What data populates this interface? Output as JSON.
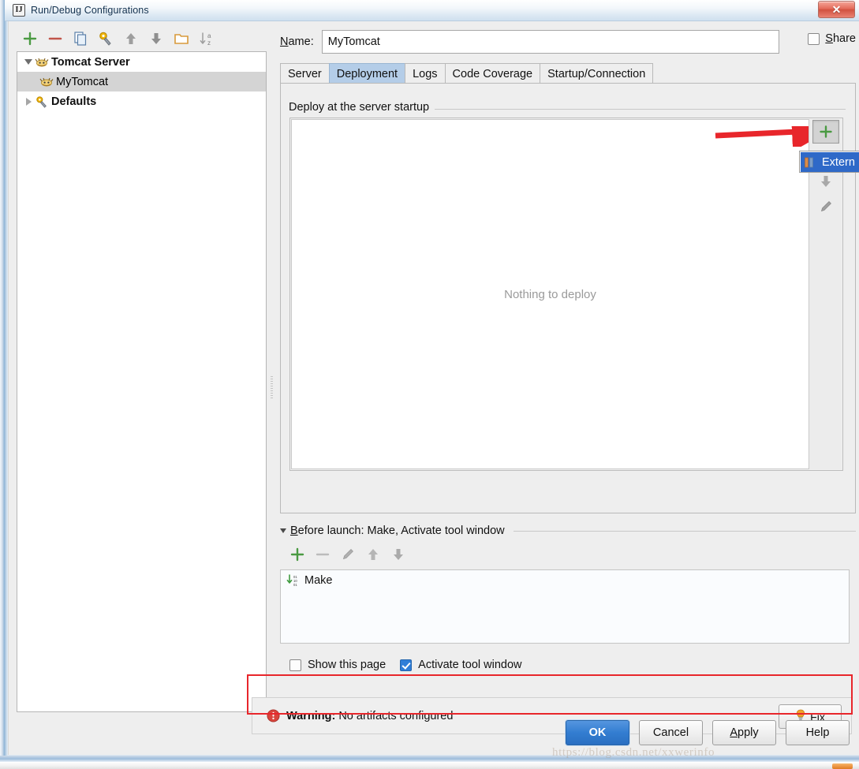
{
  "window": {
    "title": "Run/Debug Configurations",
    "app_icon": "intellij-idea-icon",
    "close_label": "✕"
  },
  "left_toolbar": {
    "items": [
      {
        "name": "add-configuration-button",
        "icon": "plus-icon",
        "tooltip": "Add New Configuration"
      },
      {
        "name": "remove-configuration-button",
        "icon": "minus-icon",
        "tooltip": "Remove Configuration"
      },
      {
        "name": "copy-configuration-button",
        "icon": "copy-icon",
        "tooltip": "Copy Configuration"
      },
      {
        "name": "edit-defaults-button",
        "icon": "wrench-gear-icon",
        "tooltip": "Edit defaults"
      },
      {
        "name": "move-up-button",
        "icon": "arrow-up-icon",
        "tooltip": "Move Up"
      },
      {
        "name": "move-down-button",
        "icon": "arrow-down-icon",
        "tooltip": "Move Down"
      },
      {
        "name": "create-folder-button",
        "icon": "folder-icon",
        "tooltip": "Create New Folder"
      },
      {
        "name": "sort-button",
        "icon": "sort-az-icon",
        "tooltip": "Sort Configurations"
      }
    ]
  },
  "tree": {
    "nodes": [
      {
        "label": "Tomcat Server",
        "expanded": true,
        "bold": true,
        "icon": "tomcat-icon",
        "selected": false,
        "level": 0
      },
      {
        "label": "MyTomcat",
        "expanded": null,
        "bold": false,
        "icon": "tomcat-icon",
        "selected": true,
        "level": 1
      },
      {
        "label": "Defaults",
        "expanded": false,
        "bold": true,
        "icon": "wrench-gear-icon",
        "selected": false,
        "level": 0
      }
    ]
  },
  "name_field": {
    "label": "Name:",
    "label_mnemonic": "N",
    "label_rest": "ame:",
    "value": "MyTomcat",
    "placeholder": ""
  },
  "share": {
    "label": "Share",
    "label_mnemonic": "S",
    "label_rest": "hare",
    "checked": false
  },
  "tabs": [
    {
      "label": "Server",
      "active": false
    },
    {
      "label": "Deployment",
      "active": true
    },
    {
      "label": "Logs",
      "active": false
    },
    {
      "label": "Code Coverage",
      "active": false
    },
    {
      "label": "Startup/Connection",
      "active": false
    }
  ],
  "deployment": {
    "group_title": "Deploy at the server startup",
    "empty_message": "Nothing to deploy",
    "side_toolbar": [
      {
        "name": "add-artifact-button",
        "icon": "plus-icon",
        "state": "pressed"
      },
      {
        "name": "move-artifact-up-button",
        "icon": "arrow-up-icon",
        "state": "disabled"
      },
      {
        "name": "move-artifact-down-button",
        "icon": "arrow-down-icon",
        "state": "disabled"
      },
      {
        "name": "edit-artifact-button",
        "icon": "pencil-icon",
        "state": "disabled"
      }
    ],
    "popup_menu": {
      "items": [
        {
          "label": "Extern",
          "icon": "external-source-icon",
          "selected": true
        }
      ]
    }
  },
  "before_launch": {
    "title": "Before launch: Make, Activate tool window",
    "title_mnemonic": "B",
    "title_rest": "efore launch: Make, Activate tool window",
    "expanded": true,
    "toolbar": [
      {
        "name": "add-task-button",
        "icon": "plus-icon",
        "state": "enabled"
      },
      {
        "name": "remove-task-button",
        "icon": "minus-icon",
        "state": "disabled"
      },
      {
        "name": "edit-task-button",
        "icon": "pencil-icon",
        "state": "disabled"
      },
      {
        "name": "task-move-up-button",
        "icon": "arrow-up-icon",
        "state": "disabled"
      },
      {
        "name": "task-move-down-button",
        "icon": "arrow-down-icon",
        "state": "disabled"
      }
    ],
    "tasks": [
      {
        "label": "Make",
        "icon": "make-build-icon"
      }
    ]
  },
  "options": {
    "show_this_page": {
      "label": "Show this page",
      "checked": false
    },
    "activate_tool_window": {
      "label": "Activate tool window",
      "checked": true
    }
  },
  "warning": {
    "icon": "warning-error-icon",
    "prefix": "Warning:",
    "message": "No artifacts configured",
    "fix_label": "Fix",
    "fix_icon": "lightbulb-icon"
  },
  "buttons": [
    {
      "label": "OK",
      "primary": true,
      "mnemonic": ""
    },
    {
      "label": "Cancel",
      "primary": false,
      "mnemonic": ""
    },
    {
      "label": "Apply",
      "primary": false,
      "mnemonic": "A",
      "rest": "pply"
    },
    {
      "label": "Help",
      "primary": false,
      "mnemonic": ""
    }
  ],
  "watermark": "https://blog.csdn.net/xxwerinfo",
  "colors": {
    "accent_blue": "#2f7ed8",
    "tab_active": "#b4cde8",
    "popup_selection": "#2f69c8",
    "annotation_red": "#e8262b",
    "warning_red": "#d9453c",
    "add_green": "#4a9a42"
  }
}
